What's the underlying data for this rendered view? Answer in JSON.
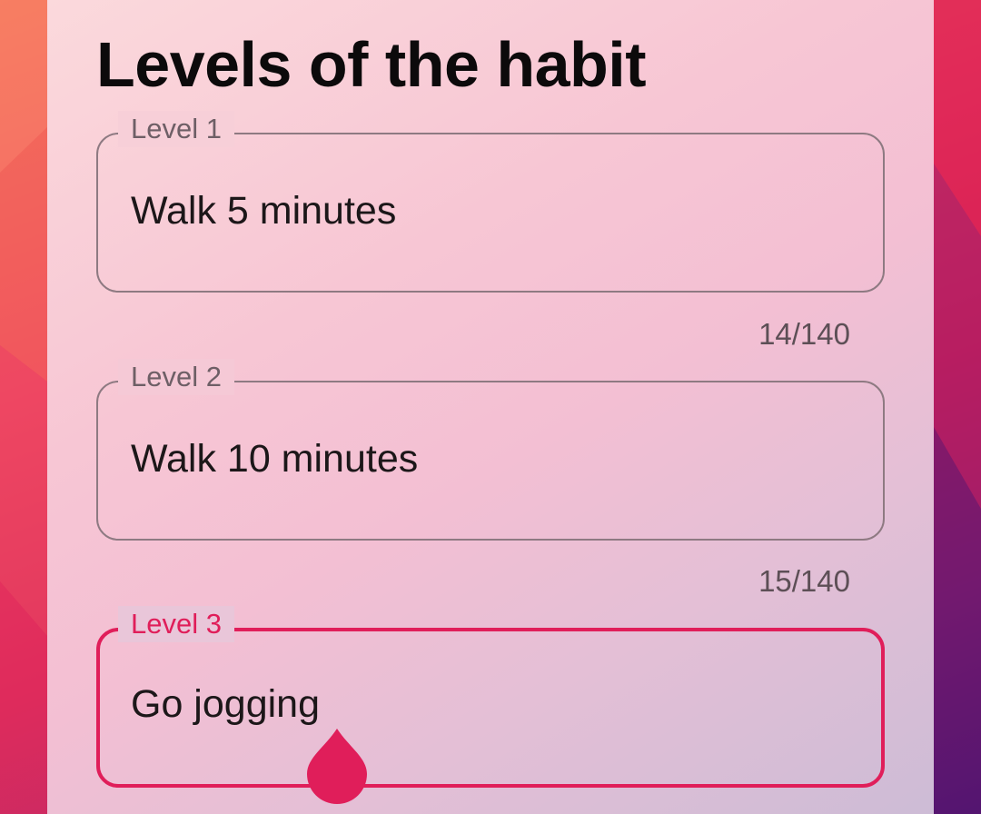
{
  "colors": {
    "accent": "#e01e5a",
    "title_text": "#0c0a0b",
    "field_outline": "#8e7a82",
    "helper_text": "#5d4f56"
  },
  "page": {
    "title": "Levels of the habit"
  },
  "levels": [
    {
      "label": "Level 1",
      "value": "Walk 5 minutes",
      "counter": "14/140",
      "focused": false
    },
    {
      "label": "Level 2",
      "value": "Walk 10 minutes",
      "counter": "15/140",
      "focused": false
    },
    {
      "label": "Level 3",
      "value": "Go jogging",
      "focused": true
    }
  ],
  "icons": {
    "text_cursor_handle": "text-cursor-handle-icon"
  }
}
